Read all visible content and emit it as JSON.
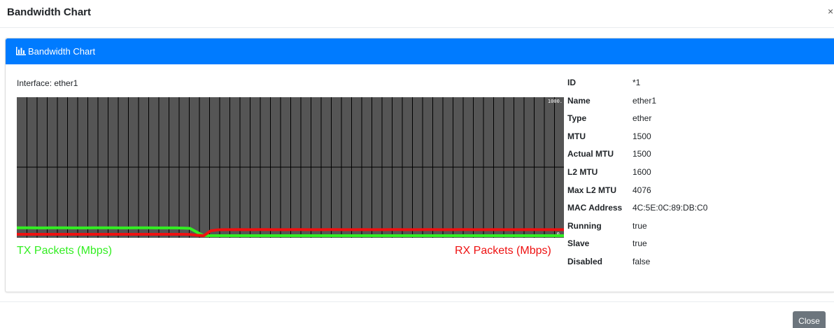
{
  "modal": {
    "title": "Bandwidth Chart",
    "close_x": "×",
    "close_button_label": "Close"
  },
  "card": {
    "header_title": "Bandwidth Chart",
    "header_icon": "bar-chart-icon",
    "interface_label": "Interface: ether1"
  },
  "colors": {
    "header_blue": "#007bff",
    "chart_bg": "#555555",
    "tx_green": "#33ee22",
    "rx_red": "#ee1111",
    "close_button_gray": "#6c757d"
  },
  "chart_data": {
    "type": "line",
    "y_tick_labels": [
      "1000.",
      "0."
    ],
    "grid": true,
    "legend": {
      "tx": "TX Packets (Mbps)",
      "rx": "RX Packets (Mbps)"
    },
    "series": [
      {
        "name": "TX Packets (Mbps)",
        "color": "#33ee22",
        "values": [
          62,
          62,
          62,
          61,
          61,
          62,
          62,
          62,
          61,
          61,
          61,
          62,
          62,
          62,
          62,
          61,
          61,
          62,
          62,
          62,
          61,
          61,
          61,
          61,
          60,
          58,
          30,
          5,
          5,
          5,
          5,
          5,
          5,
          5,
          5,
          5,
          5,
          5,
          5,
          5,
          5,
          5,
          5,
          5,
          5,
          5,
          5,
          5,
          5,
          5,
          5,
          5,
          5,
          5,
          5,
          5,
          5,
          5,
          5,
          5,
          5,
          5,
          5,
          5,
          5,
          5,
          5,
          5,
          5,
          5,
          5,
          5,
          5,
          5,
          5,
          5,
          5,
          5,
          5,
          5
        ]
      },
      {
        "name": "RX Packets (Mbps)",
        "color": "#ee1111",
        "values": [
          15,
          15,
          15,
          15,
          15,
          15,
          15,
          15,
          15,
          15,
          15,
          15,
          15,
          15,
          15,
          15,
          15,
          15,
          15,
          15,
          15,
          15,
          15,
          15,
          15,
          14,
          8,
          5,
          40,
          47,
          48,
          48,
          49,
          48,
          48,
          49,
          49,
          48,
          48,
          48,
          49,
          49,
          48,
          48,
          48,
          49,
          49,
          48,
          48,
          48,
          49,
          48,
          48,
          48,
          49,
          49,
          48,
          48,
          48,
          49,
          49,
          48,
          48,
          48,
          49,
          49,
          48,
          48,
          48,
          49,
          48,
          48,
          48,
          48,
          49,
          48,
          48,
          48,
          48,
          48
        ]
      }
    ]
  },
  "info": [
    {
      "key": "ID",
      "value": "*1"
    },
    {
      "key": "Name",
      "value": "ether1"
    },
    {
      "key": "Type",
      "value": "ether"
    },
    {
      "key": "MTU",
      "value": "1500"
    },
    {
      "key": "Actual MTU",
      "value": "1500"
    },
    {
      "key": "L2 MTU",
      "value": "1600"
    },
    {
      "key": "Max L2 MTU",
      "value": "4076"
    },
    {
      "key": "MAC Address",
      "value": "4C:5E:0C:89:DB:C0"
    },
    {
      "key": "Running",
      "value": "true"
    },
    {
      "key": "Slave",
      "value": "true"
    },
    {
      "key": "Disabled",
      "value": "false"
    }
  ]
}
